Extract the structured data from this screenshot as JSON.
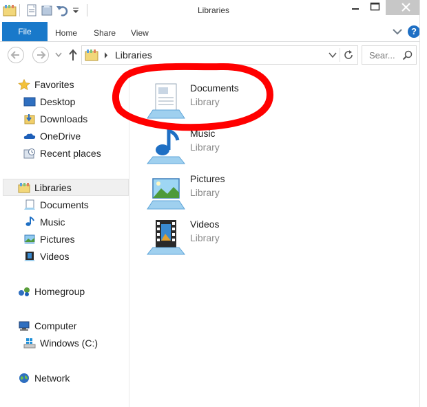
{
  "window": {
    "title": "Libraries",
    "controls": [
      "minimize-icon",
      "maximize-icon",
      "close-icon"
    ]
  },
  "ribbon": {
    "file_label": "File",
    "tabs": [
      {
        "label": "Home"
      },
      {
        "label": "Share"
      },
      {
        "label": "View"
      }
    ],
    "help_icon": "?",
    "accent_color": "#1979ca"
  },
  "address": {
    "path_label": "Libraries",
    "search_placeholder": "Sear..."
  },
  "sidebar": {
    "favorites": {
      "label": "Favorites",
      "items": [
        {
          "label": "Desktop"
        },
        {
          "label": "Downloads"
        },
        {
          "label": "OneDrive"
        },
        {
          "label": "Recent places"
        }
      ]
    },
    "libraries": {
      "label": "Libraries",
      "items": [
        {
          "label": "Documents"
        },
        {
          "label": "Music"
        },
        {
          "label": "Pictures"
        },
        {
          "label": "Videos"
        }
      ]
    },
    "homegroup": {
      "label": "Homegroup"
    },
    "computer": {
      "label": "Computer",
      "items": [
        {
          "label": "Windows (C:)"
        }
      ]
    },
    "network": {
      "label": "Network"
    }
  },
  "main": {
    "libraries": [
      {
        "name": "Documents",
        "type": "Library",
        "icon": "documents-library-icon"
      },
      {
        "name": "Music",
        "type": "Library",
        "icon": "music-library-icon"
      },
      {
        "name": "Pictures",
        "type": "Library",
        "icon": "pictures-library-icon"
      },
      {
        "name": "Videos",
        "type": "Library",
        "icon": "videos-library-icon"
      }
    ],
    "annotation_color": "#ff0000"
  }
}
